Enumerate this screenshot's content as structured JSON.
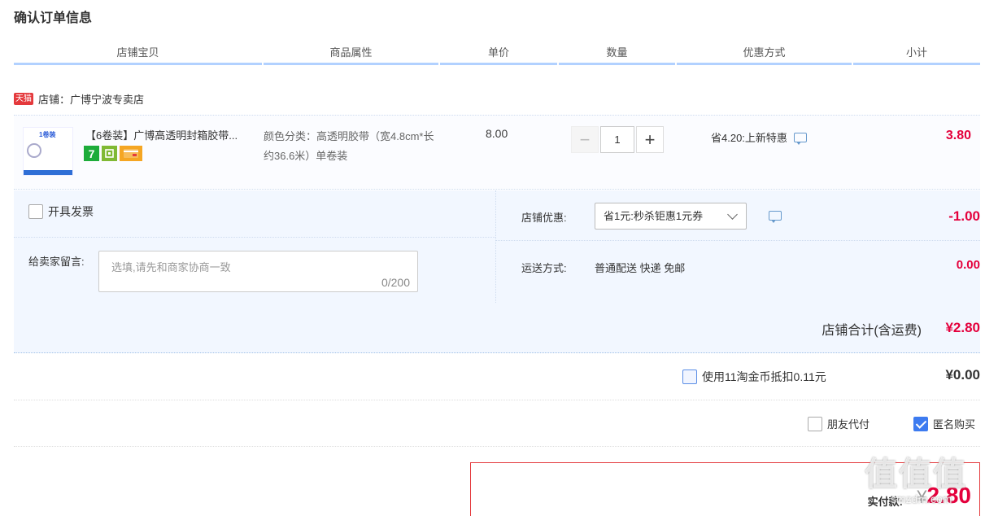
{
  "page_title": "确认订单信息",
  "columns": [
    "店铺宝贝",
    "商品属性",
    "单价",
    "数量",
    "优惠方式",
    "小计"
  ],
  "shop": {
    "badge": "天猫",
    "name_label": "店铺：广博宁波专卖店"
  },
  "item": {
    "thumb_text": "1卷装",
    "name": "【6卷装】广博高透明封箱胶带...",
    "badge_7": "7",
    "attrs": "颜色分类：高透明胶带（宽4.8cm*长约36.6米）单卷装",
    "price": "8.00",
    "qty": "1",
    "qty_minus": "−",
    "qty_plus": "+",
    "discount": "省4.20:上新特惠",
    "subtotal": "3.80"
  },
  "invoice_label": "开具发票",
  "message": {
    "label": "给卖家留言:",
    "placeholder": "选填,请先和商家协商一致",
    "count": "0/200"
  },
  "shop_discount": {
    "label": "店铺优惠:",
    "selected": "省1元:秒杀钜惠1元券",
    "amount": "-1.00"
  },
  "shipping": {
    "label": "运送方式:",
    "value": "普通配送 快递 免邮",
    "amount": "0.00"
  },
  "shop_total": {
    "label": "店铺合计(含运费)",
    "value": "¥2.80"
  },
  "coin": {
    "label": "使用11淘金币抵扣0.11元",
    "value": "¥0.00"
  },
  "friend_pay": "朋友代付",
  "anonymous": "匿名购买",
  "payment": {
    "label": "实付款:",
    "currency": "¥",
    "value": "2.80"
  },
  "watermark": {
    "main": "值值值",
    "sub": "smzdm.com"
  },
  "colors": {
    "price_red": "#e4003c",
    "header_line": "#b2d1ff",
    "option_bg": "#f2f7ff",
    "accent_blue": "#3d7bf0"
  }
}
